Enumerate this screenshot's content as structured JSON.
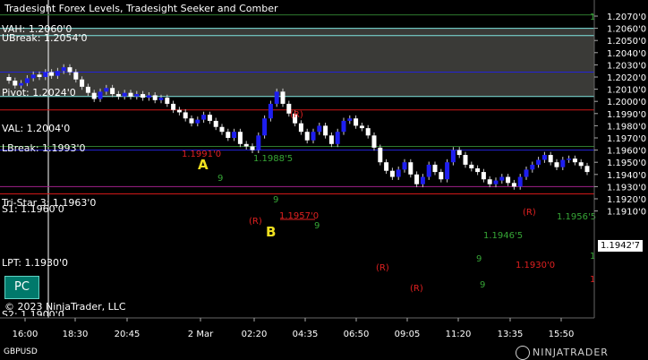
{
  "window": {
    "title": "Tradesight Forex Levels, Tradesight Seeker and Comber",
    "symbol": "GBPUSD",
    "copyright": "© 2023 NinjaTrader, LLC",
    "brand": "NINJATRADER",
    "pc_button": "PC",
    "last_price": "1.1942'7"
  },
  "level_labels": [
    "VAH: 1.2060'0",
    "UBreak: 1.2054'0",
    "Pivot: 1.2024'0",
    "VAL: 1.2004'0",
    "LBreak: 1.1993'0",
    "Tri-Star 3: 1.1963'0",
    "S1: 1.1960'0",
    "LPT: 1.1930'0",
    "S2: 1.1900'0"
  ],
  "price_axis": [
    "1.2070'0",
    "1.2060'0",
    "1.2050'0",
    "1.2040'0",
    "1.2030'0",
    "1.2020'0",
    "1.2010'0",
    "1.2000'0",
    "1.1990'0",
    "1.1980'0",
    "1.1970'0",
    "1.1960'0",
    "1.1950'0",
    "1.1940'0",
    "1.1930'0",
    "1.1920'0",
    "1.1910'0"
  ],
  "time_axis": [
    "16:00",
    "18:30",
    "20:45",
    "2 Mar",
    "02:20",
    "04:35",
    "06:50",
    "09:05",
    "11:20",
    "13:35",
    "15:50"
  ],
  "annotations": {
    "marker_a": "A",
    "marker_b": "B",
    "r_label": "(R)",
    "red_prices": [
      "1.1991'0",
      "1.1957'0",
      "1.1930'0"
    ],
    "green_prices": [
      "1.1988'5",
      "1.1946'5",
      "1.1956'5"
    ],
    "right_ones": [
      "1",
      "1",
      "1"
    ],
    "green_nines": [
      "9",
      "9",
      "9",
      "9",
      "9"
    ]
  },
  "colors": {
    "background": "#000000",
    "value_area": "#3a3a37",
    "cyan_level": "#7fe6e0",
    "pivot_blue": "#2323d8",
    "lbreak_red": "#d01818",
    "lpt_magenta": "#a0208a",
    "bar_blue": "#1e1ef0",
    "bar_white": "#ffffff",
    "seeker_green": "#36a636",
    "comber_red": "#e02020",
    "marker_yellow": "#f0e020"
  },
  "chart_data": {
    "type": "candlestick",
    "symbol": "GBPUSD",
    "ylim": [
      1.1905,
      1.2078
    ],
    "x_ticks": [
      "16:00",
      "18:30",
      "20:45",
      "2 Mar",
      "02:20",
      "04:35",
      "06:50",
      "09:05",
      "11:20",
      "13:35",
      "15:50"
    ],
    "close_path": [
      1.2017,
      1.2013,
      1.2015,
      1.2019,
      1.2022,
      1.202,
      1.2024,
      1.2021,
      1.2025,
      1.2028,
      1.2024,
      1.2018,
      1.2012,
      1.2007,
      1.2002,
      1.2008,
      1.2011,
      1.2006,
      1.2004,
      1.2007,
      1.2004,
      1.2006,
      1.2003,
      1.2005,
      1.2001,
      1.2003,
      1.1998,
      1.1993,
      1.1991,
      1.1986,
      1.1982,
      1.1985,
      1.1989,
      1.1984,
      1.1979,
      1.1975,
      1.197,
      1.1975,
      1.1965,
      1.1963,
      1.196,
      1.1972,
      1.1986,
      1.1998,
      1.2008,
      1.1998,
      1.199,
      1.1982,
      1.1975,
      1.1968,
      1.1975,
      1.198,
      1.1972,
      1.1965,
      1.1975,
      1.1984,
      1.1986,
      1.198,
      1.1978,
      1.1972,
      1.1962,
      1.195,
      1.1943,
      1.1938,
      1.1944,
      1.195,
      1.194,
      1.1932,
      1.1938,
      1.1948,
      1.1942,
      1.1936,
      1.195,
      1.196,
      1.1956,
      1.1948,
      1.1945,
      1.1942,
      1.1936,
      1.1932,
      1.1935,
      1.1938,
      1.1933,
      1.193,
      1.1938,
      1.1944,
      1.1948,
      1.1952,
      1.1956,
      1.195,
      1.1946,
      1.1952,
      1.1953,
      1.195,
      1.1947,
      1.1942
    ],
    "levels": [
      {
        "label": "VAH",
        "value": 1.206
      },
      {
        "label": "UBreak",
        "value": 1.2054
      },
      {
        "label": "Pivot",
        "value": 1.2024
      },
      {
        "label": "VAL",
        "value": 1.2004
      },
      {
        "label": "LBreak",
        "value": 1.1993
      },
      {
        "label": "Tri-Star 3",
        "value": 1.1963
      },
      {
        "label": "S1",
        "value": 1.196
      },
      {
        "label": "LPT",
        "value": 1.193
      },
      {
        "label": "S2",
        "value": 1.19
      }
    ],
    "value_area": [
      1.2004,
      1.206
    ],
    "top_green_line": 1.2071,
    "bottom_red_line": 1.1924
  }
}
